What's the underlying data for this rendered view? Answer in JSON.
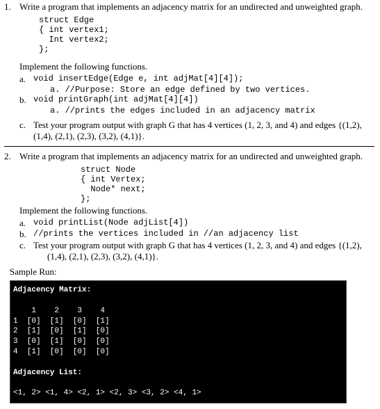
{
  "q1": {
    "number": "1.",
    "prompt": "Write a program that implements an adjacency matrix for an undirected and unweighted graph.",
    "struct_code": "struct Edge\n{ int vertex1;\n  Int vertex2;\n};",
    "implement_label": "Implement the following functions.",
    "a_letter": "a.",
    "a_code": "void insertEdge(Edge e, int adjMat[4][4]);",
    "a_purpose": "a. //Purpose: Store an edge defined by two vertices.",
    "b_letter": "b.",
    "b_code": "void printGraph(int adjMat[4][4])",
    "b_purpose": "a. //prints the edges included in an adjacency matrix",
    "c_letter": "c.",
    "c_text": "Test your program output with graph G that has 4 vertices (1, 2, 3, and 4) and edges {(1,2),",
    "c_text2": "(1,4), (2,1), (2,3), (3,2), (4,1)}."
  },
  "q2": {
    "number": "2.",
    "prompt": "Write a program that implements an adjacency matrix for an undirected and unweighted graph.",
    "struct_code": "struct Node\n{ int Vertex;\n  Node* next;\n};",
    "implement_label": "Implement the following functions.",
    "a_letter": "a.",
    "a_code": "void printList(Node adjList[4])",
    "b_letter": "b.",
    "b_code": "//prints the vertices included in //an adjacency list",
    "c_letter": "c.",
    "c_text": "Test your program output with graph G that has 4 vertices (1, 2, 3, and 4) and edges {(1,2),",
    "c_text2": "(1,4), (2,1), (2,3), (3,2), (4,1)}."
  },
  "sample": {
    "label": "Sample Run:",
    "matrix_header": "Adjacency Matrix:",
    "matrix_cols": "    1    2    3    4",
    "matrix_row1": "1  [0]  [1]  [0]  [1]",
    "matrix_row2": "2  [1]  [0]  [1]  [0]",
    "matrix_row3": "3  [0]  [1]  [0]  [0]",
    "matrix_row4": "4  [1]  [0]  [0]  [0]",
    "list_header": "Adjacency List:",
    "list_line": "<1, 2> <1, 4> <2, 1> <2, 3> <3, 2> <4, 1>"
  },
  "chart_data": {
    "type": "table",
    "title": "Adjacency Matrix",
    "columns": [
      "1",
      "2",
      "3",
      "4"
    ],
    "rows": [
      "1",
      "2",
      "3",
      "4"
    ],
    "values": [
      [
        0,
        1,
        0,
        1
      ],
      [
        1,
        0,
        1,
        0
      ],
      [
        0,
        1,
        0,
        0
      ],
      [
        1,
        0,
        0,
        0
      ]
    ],
    "adjacency_list": [
      [
        1,
        2
      ],
      [
        1,
        4
      ],
      [
        2,
        1
      ],
      [
        2,
        3
      ],
      [
        3,
        2
      ],
      [
        4,
        1
      ]
    ]
  }
}
